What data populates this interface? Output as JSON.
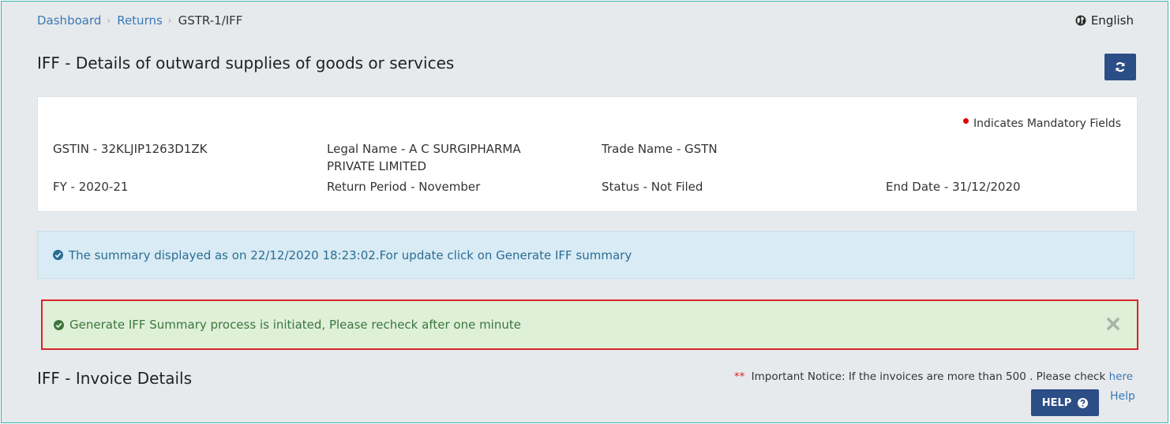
{
  "breadcrumb": {
    "items": [
      "Dashboard",
      "Returns"
    ],
    "current": "GSTR-1/IFF"
  },
  "language": {
    "label": "English"
  },
  "page_title": "IFF - Details of outward supplies of goods or services",
  "info": {
    "mandatory_note": "Indicates Mandatory Fields",
    "gstin": "GSTIN - 32KLJIP1263D1ZK",
    "legal_name_line1": "Legal Name - A C SURGIPHARMA",
    "legal_name_line2": "PRIVATE LIMITED",
    "trade_name": "Trade Name - GSTN",
    "fy": "FY - 2020-21",
    "return_period": "Return Period - November",
    "status": "Status - Not Filed",
    "end_date": "End Date - 31/12/2020"
  },
  "alerts": {
    "info_text": "The summary displayed as on 22/12/2020 18:23:02.For update click on Generate IFF summary",
    "success_text": "Generate IFF Summary process is initiated, Please recheck after one minute"
  },
  "invoice_section": {
    "title": "IFF - Invoice Details",
    "notice_stars": "**",
    "notice_text": "Important Notice: If the invoices are more than 500 . Please check",
    "notice_link": "here",
    "help_button": "HELP",
    "help_link": "Help"
  },
  "colors": {
    "primary_button": "#2c4e86",
    "link": "#3b78b6",
    "info_bg": "#d9ebf4",
    "success_bg": "#dff0d8",
    "highlight_border": "#d9252a"
  },
  "icons": {
    "language": "globe-icon",
    "refresh": "refresh-icon",
    "info": "check-circle-icon",
    "success": "check-circle-icon",
    "close": "close-icon",
    "help": "question-circle-icon"
  }
}
